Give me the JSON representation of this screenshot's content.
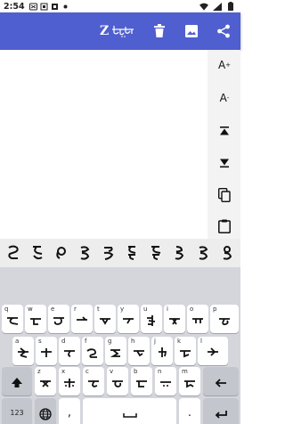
{
  "status_bar": {
    "time": "2:54",
    "icons": [
      "cast-icon",
      "sim-icon",
      "notification-icon",
      "dot-icon"
    ],
    "right_icons": [
      "wifi-icon",
      "signal-icon",
      "battery-icon"
    ]
  },
  "app_bar": {
    "logo_letter": "Z",
    "background": "#4f5fcf",
    "actions": [
      "trash-icon",
      "image-icon",
      "share-icon"
    ]
  },
  "editor": {
    "text": ""
  },
  "side_panel": {
    "font_increase": "A",
    "font_increase_mark": "+",
    "font_decrease": "A",
    "font_decrease_mark": "-",
    "buttons": [
      "move-to-top-icon",
      "move-to-bottom-icon",
      "copy-icon",
      "paste-icon"
    ]
  },
  "suggestions": {
    "count": 10
  },
  "keyboard": {
    "row1_hints": [
      "q",
      "w",
      "e",
      "r",
      "t",
      "y",
      "u",
      "i",
      "o",
      "p"
    ],
    "row2_hints": [
      "a",
      "s",
      "d",
      "f",
      "g",
      "h",
      "j",
      "k",
      "l"
    ],
    "row3_hints": [
      "z",
      "x",
      "c",
      "v",
      "b",
      "n",
      "m"
    ],
    "bottom": {
      "numbers_label": "123",
      "comma_label": ",",
      "period_label": "."
    },
    "fn_color": "#c3c6cd"
  }
}
